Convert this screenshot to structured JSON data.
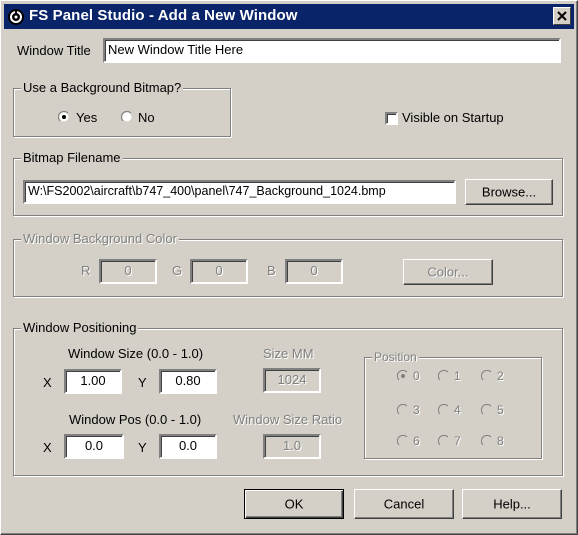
{
  "window": {
    "title": "FS Panel Studio - Add a New Window"
  },
  "title_field": {
    "label": "Window Title",
    "value": "New Window Title Here"
  },
  "background": {
    "group_label": "Use a Background Bitmap?",
    "yes_label": "Yes",
    "no_label": "No",
    "selected": "Yes",
    "visible_label": "Visible on Startup",
    "visible_checked": false
  },
  "bitmap": {
    "group_label": "Bitmap Filename",
    "value": "W:\\FS2002\\aircraft\\b747_400\\panel\\747_Background_1024.bmp",
    "browse_label": "Browse..."
  },
  "bgcolor": {
    "group_label": "Window Background Color",
    "r_label": "R",
    "r_value": "0",
    "g_label": "G",
    "g_value": "0",
    "b_label": "B",
    "b_value": "0",
    "color_button_label": "Color..."
  },
  "positioning": {
    "group_label": "Window Positioning",
    "size_label": "Window Size (0.0 - 1.0)",
    "size_x_label": "X",
    "size_x_value": "1.00",
    "size_y_label": "Y",
    "size_y_value": "0.80",
    "pos_label": "Window Pos (0.0 - 1.0)",
    "pos_x_label": "X",
    "pos_x_value": "0.0",
    "pos_y_label": "Y",
    "pos_y_value": "0.0",
    "size_mm_label": "Size MM",
    "size_mm_value": "1024",
    "ratio_label": "Window Size Ratio",
    "ratio_value": "1.0",
    "position_group_label": "Position",
    "position_options": [
      "0",
      "1",
      "2",
      "3",
      "4",
      "5",
      "6",
      "7",
      "8"
    ],
    "position_selected": "0"
  },
  "buttons": {
    "ok": "OK",
    "cancel": "Cancel",
    "help": "Help..."
  },
  "colors": {
    "titlebar": "#0a246a",
    "face": "#d4d0c8",
    "disabled_text": "#808080"
  }
}
